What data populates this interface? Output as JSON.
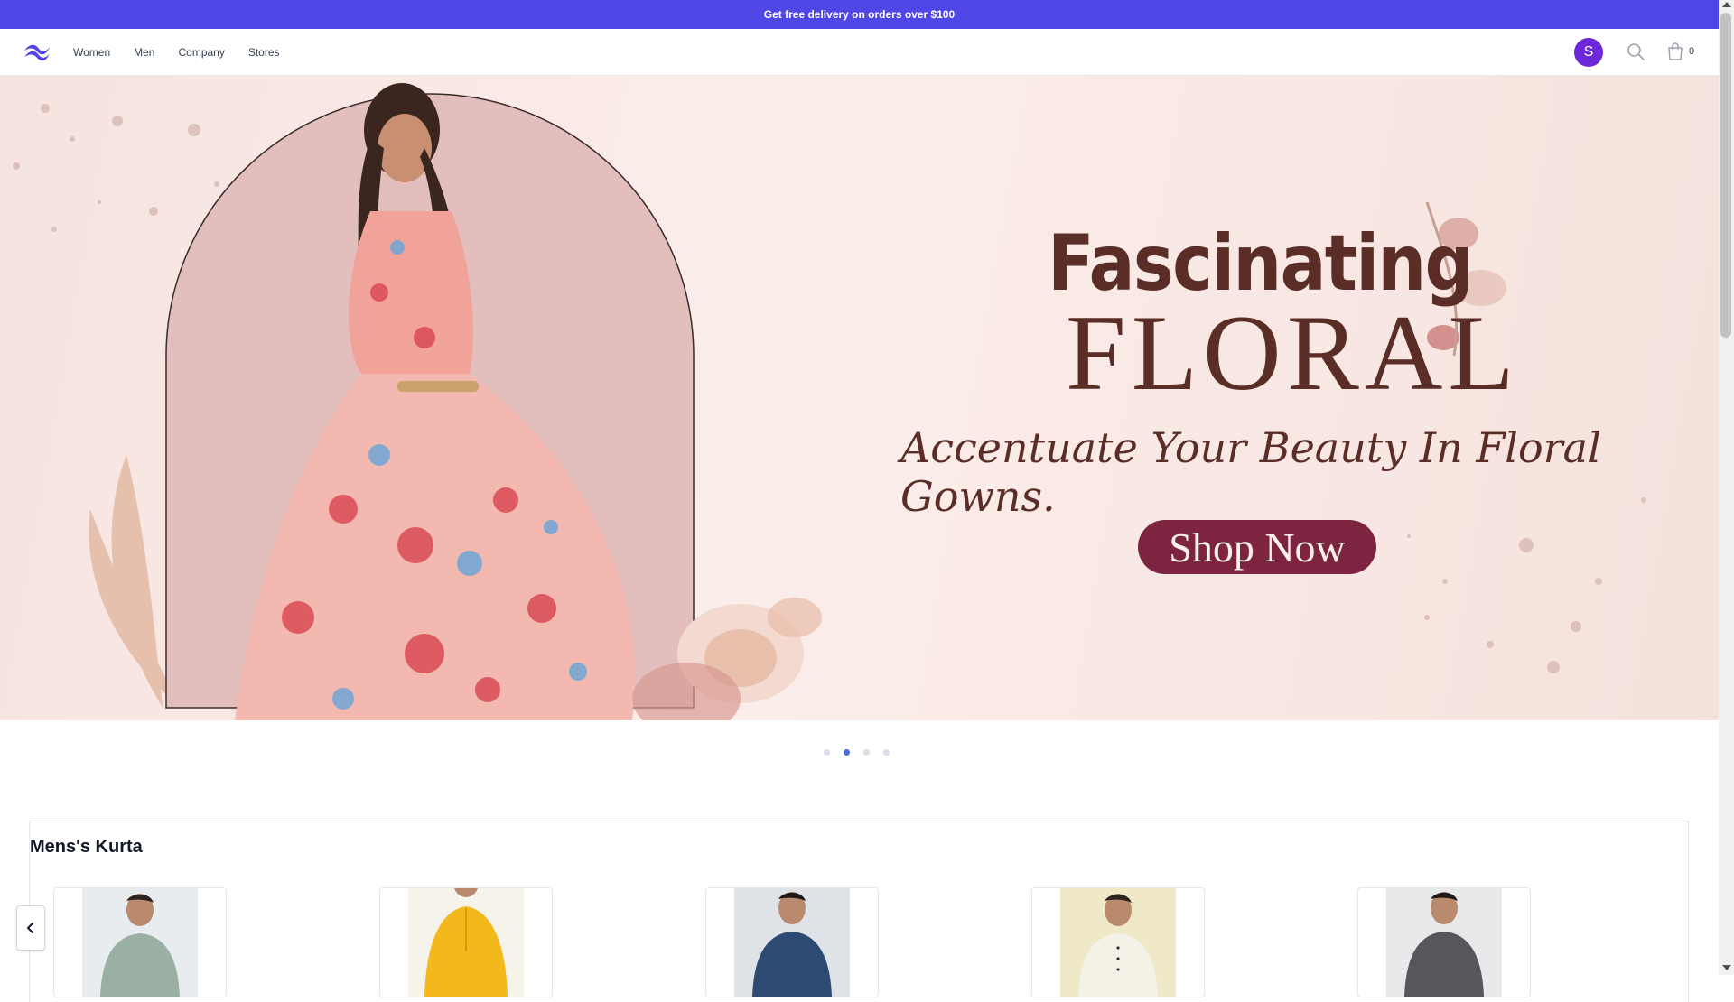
{
  "announcement": {
    "text": "Get free delivery on orders over $100"
  },
  "nav": {
    "links": [
      "Women",
      "Men",
      "Company",
      "Stores"
    ],
    "avatar_initial": "S",
    "cart_count": "0"
  },
  "hero": {
    "title_line1": "Fascinating",
    "title_line2": "FLORAL",
    "subtitle": "Accentuate Your Beauty In Floral Gowns.",
    "cta": "Shop Now"
  },
  "carousel": {
    "slides": 4,
    "active": 2
  },
  "section": {
    "title": "Mens's Kurta",
    "cards": [
      {
        "color": "#9bb0a4",
        "bg": "#e9ecef"
      },
      {
        "color": "#f2b81c",
        "bg": "#f6f3ea"
      },
      {
        "color": "#2c4a72",
        "bg": "#dfe3e8"
      },
      {
        "color": "#f4f1e6",
        "bg": "#efe9c7"
      },
      {
        "color": "#55575a",
        "bg": "#e8e9eb"
      }
    ]
  },
  "colors": {
    "accent": "#4f46e5",
    "hero_text": "#5a2d27",
    "cta_bg": "#7c2440",
    "avatar": "#6d28d9"
  }
}
